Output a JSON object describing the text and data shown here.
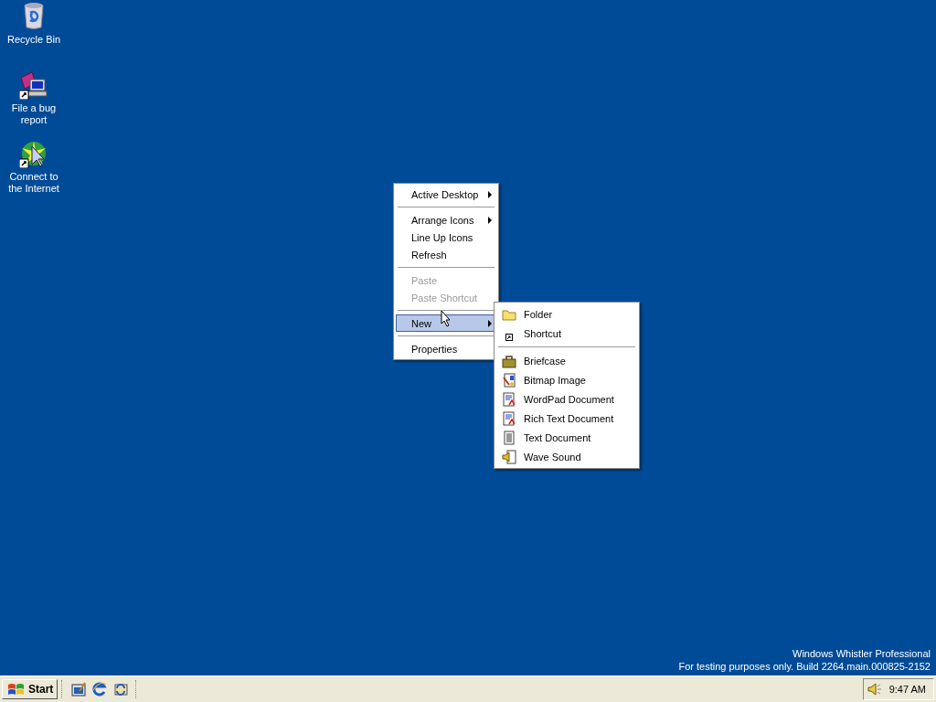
{
  "desktop_icons": [
    {
      "label": "Recycle Bin",
      "shortcut": false
    },
    {
      "label": "File a bug report",
      "shortcut": true
    },
    {
      "label": "Connect to the Internet",
      "shortcut": true
    }
  ],
  "context_menu": {
    "items": [
      {
        "kind": "item",
        "label": "Active Desktop",
        "submenu": true,
        "disabled": false,
        "selected": false
      },
      {
        "kind": "separator"
      },
      {
        "kind": "item",
        "label": "Arrange Icons",
        "submenu": true,
        "disabled": false,
        "selected": false
      },
      {
        "kind": "item",
        "label": "Line Up Icons",
        "submenu": false,
        "disabled": false,
        "selected": false
      },
      {
        "kind": "item",
        "label": "Refresh",
        "submenu": false,
        "disabled": false,
        "selected": false
      },
      {
        "kind": "separator"
      },
      {
        "kind": "item",
        "label": "Paste",
        "submenu": false,
        "disabled": true,
        "selected": false
      },
      {
        "kind": "item",
        "label": "Paste Shortcut",
        "submenu": false,
        "disabled": true,
        "selected": false
      },
      {
        "kind": "separator"
      },
      {
        "kind": "item",
        "label": "New",
        "submenu": true,
        "disabled": false,
        "selected": true
      },
      {
        "kind": "separator"
      },
      {
        "kind": "item",
        "label": "Properties",
        "submenu": false,
        "disabled": false,
        "selected": false
      }
    ]
  },
  "new_submenu": {
    "items": [
      {
        "kind": "item",
        "label": "Folder"
      },
      {
        "kind": "item",
        "label": "Shortcut"
      },
      {
        "kind": "separator"
      },
      {
        "kind": "item",
        "label": "Briefcase"
      },
      {
        "kind": "item",
        "label": "Bitmap Image"
      },
      {
        "kind": "item",
        "label": "WordPad Document"
      },
      {
        "kind": "item",
        "label": "Rich Text Document"
      },
      {
        "kind": "item",
        "label": "Text Document"
      },
      {
        "kind": "item",
        "label": "Wave Sound"
      }
    ]
  },
  "desktop_notice": [
    "Windows Whistler Professional",
    "For testing purposes only. Build 2264.main.000825-2152"
  ],
  "taskbar": {
    "start_label": "Start",
    "clock": "9:47 AM"
  }
}
